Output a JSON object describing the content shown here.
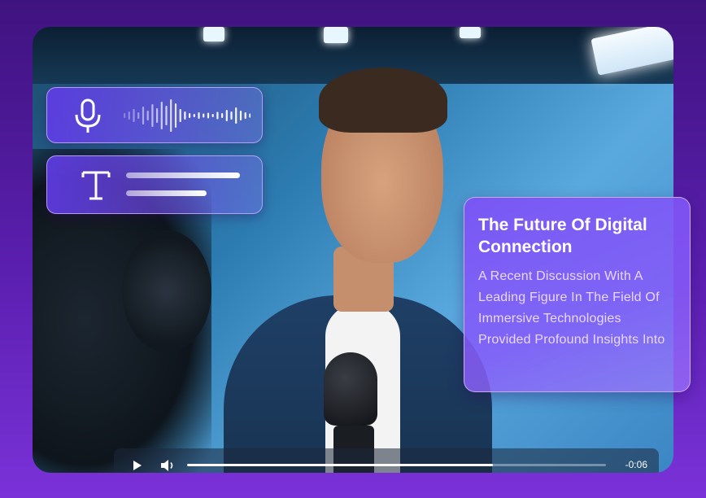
{
  "card": {
    "title": "The Future Of Digital Connection",
    "body": "A Recent Discussion With A Leading Figure In The Field Of Immersive Technologies Provided Profound Insights Into"
  },
  "player": {
    "time_remaining": "-0:06",
    "progress_fraction": 0.73
  },
  "icons": {
    "audio": "microphone-icon",
    "waveform": "waveform-icon",
    "text": "text-t-icon",
    "play": "play-icon",
    "volume": "volume-icon"
  },
  "colors": {
    "background": "#4a1897",
    "panel": "#6a46e8",
    "card": "#7c52f6"
  }
}
